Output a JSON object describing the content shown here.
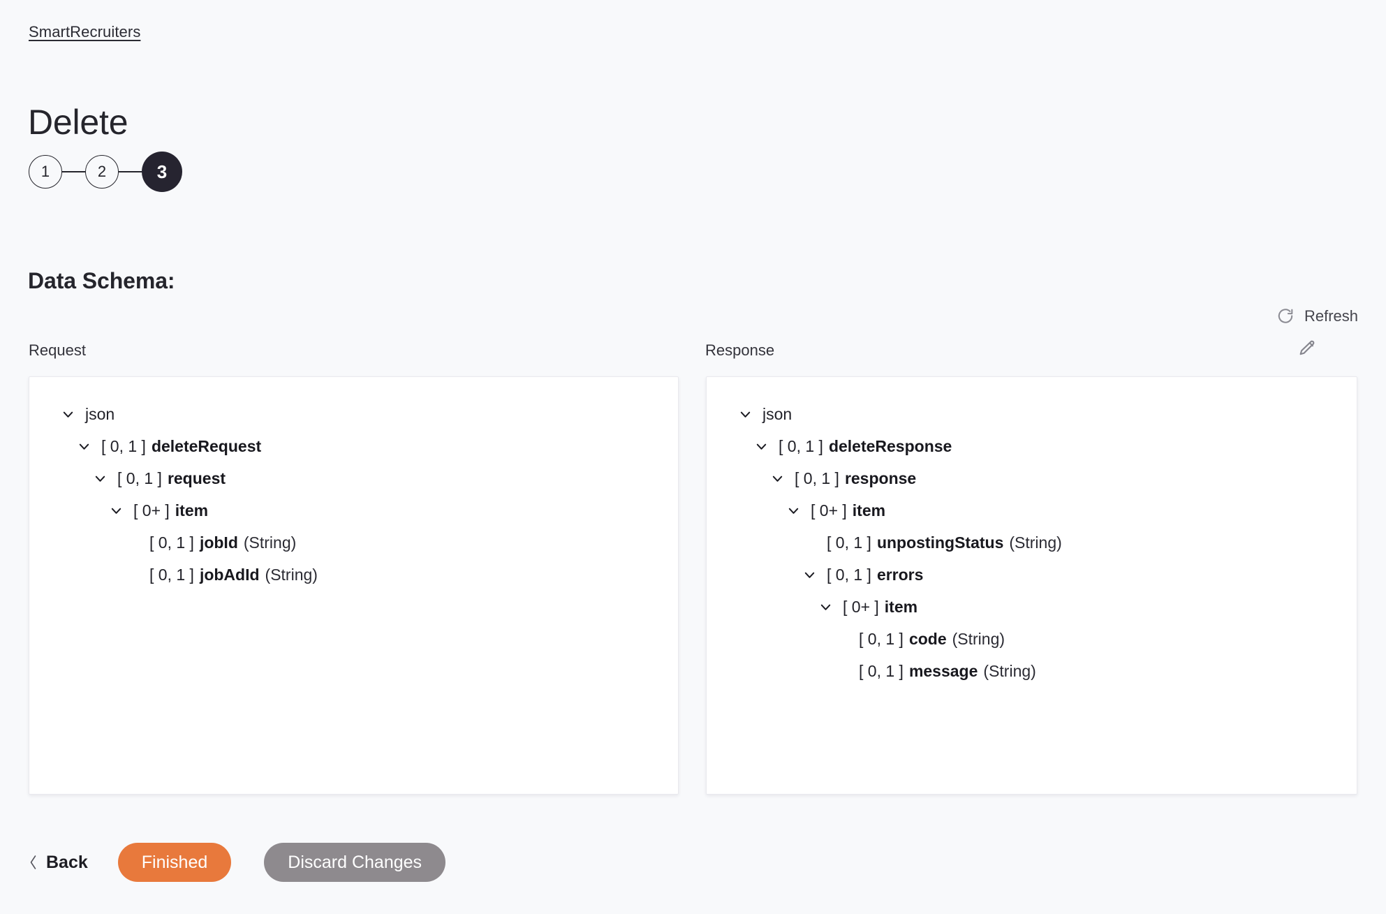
{
  "header": {
    "breadcrumb_link": "SmartRecruiters",
    "title": "Delete"
  },
  "stepper": {
    "steps": [
      {
        "label": "1",
        "state": "inactive"
      },
      {
        "label": "2",
        "state": "inactive"
      },
      {
        "label": "3",
        "state": "active"
      }
    ]
  },
  "section": {
    "title": "Data Schema:"
  },
  "toolbar": {
    "refresh_label": "Refresh",
    "refresh_icon": "refresh-icon",
    "edit_icon": "pencil-icon"
  },
  "panels": {
    "request": {
      "label": "Request",
      "tree": [
        {
          "indent": 0,
          "caret": "chevron-down",
          "mult": "",
          "name": "json",
          "bold": false,
          "type": ""
        },
        {
          "indent": 1,
          "caret": "chevron-down",
          "mult": "[ 0, 1 ]",
          "name": "deleteRequest",
          "bold": true,
          "type": ""
        },
        {
          "indent": 2,
          "caret": "chevron-down",
          "mult": "[ 0, 1 ]",
          "name": "request",
          "bold": true,
          "type": ""
        },
        {
          "indent": 3,
          "caret": "chevron-down",
          "mult": "[ 0+ ]",
          "name": "item",
          "bold": true,
          "type": ""
        },
        {
          "indent": 4,
          "caret": "",
          "mult": "[ 0, 1 ]",
          "name": "jobId",
          "bold": true,
          "type": "(String)"
        },
        {
          "indent": 4,
          "caret": "",
          "mult": "[ 0, 1 ]",
          "name": "jobAdId",
          "bold": true,
          "type": "(String)"
        }
      ]
    },
    "response": {
      "label": "Response",
      "tree": [
        {
          "indent": 0,
          "caret": "chevron-down",
          "mult": "",
          "name": "json",
          "bold": false,
          "type": ""
        },
        {
          "indent": 1,
          "caret": "chevron-down",
          "mult": "[ 0, 1 ]",
          "name": "deleteResponse",
          "bold": true,
          "type": ""
        },
        {
          "indent": 2,
          "caret": "chevron-down",
          "mult": "[ 0, 1 ]",
          "name": "response",
          "bold": true,
          "type": ""
        },
        {
          "indent": 3,
          "caret": "chevron-down",
          "mult": "[ 0+ ]",
          "name": "item",
          "bold": true,
          "type": ""
        },
        {
          "indent": 4,
          "caret": "",
          "mult": "[ 0, 1 ]",
          "name": "unpostingStatus",
          "bold": true,
          "type": "(String)"
        },
        {
          "indent": 4,
          "caret": "chevron-down",
          "mult": "[ 0, 1 ]",
          "name": "errors",
          "bold": true,
          "type": ""
        },
        {
          "indent": 5,
          "caret": "chevron-down",
          "mult": "[ 0+ ]",
          "name": "item",
          "bold": true,
          "type": ""
        },
        {
          "indent": 6,
          "caret": "",
          "mult": "[ 0, 1 ]",
          "name": "code",
          "bold": true,
          "type": "(String)"
        },
        {
          "indent": 6,
          "caret": "",
          "mult": "[ 0, 1 ]",
          "name": "message",
          "bold": true,
          "type": "(String)"
        }
      ]
    }
  },
  "footer": {
    "back_label": "Back",
    "back_icon": "chevron-left-icon",
    "finished_label": "Finished",
    "discard_label": "Discard Changes"
  },
  "colors": {
    "page_background": "#f8f9fb",
    "card_background": "#ffffff",
    "primary_button": "#e8793c",
    "secondary_button": "#8e8a8e",
    "active_step": "#262430",
    "text": "#24242b"
  }
}
